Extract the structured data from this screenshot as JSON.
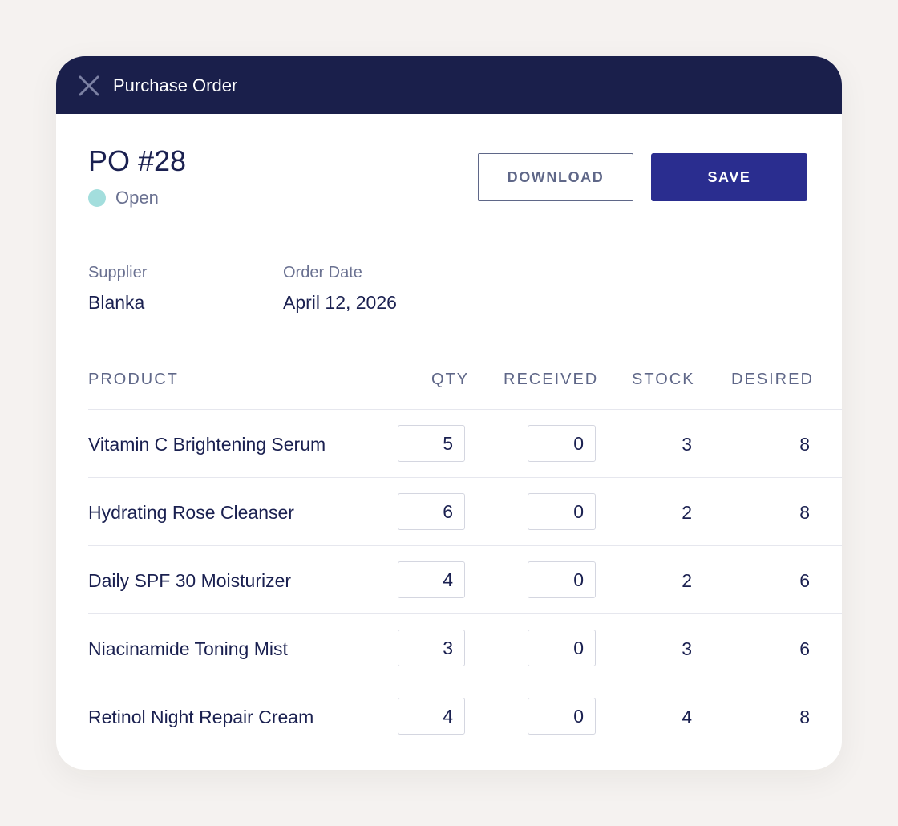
{
  "window": {
    "title": "Purchase Order"
  },
  "order": {
    "number": "PO #28",
    "status": "Open",
    "status_color": "#a3dedd"
  },
  "actions": {
    "download_label": "DOWNLOAD",
    "save_label": "SAVE"
  },
  "meta": {
    "supplier_label": "Supplier",
    "supplier_value": "Blanka",
    "date_label": "Order Date",
    "date_value": "April 12, 2026"
  },
  "table": {
    "headers": {
      "product": "PRODUCT",
      "qty": "QTY",
      "received": "RECEIVED",
      "stock": "STOCK",
      "desired": "DESIRED"
    },
    "rows": [
      {
        "product": "Vitamin C Brightening Serum",
        "qty": "5",
        "received": "0",
        "stock": "3",
        "desired": "8"
      },
      {
        "product": "Hydrating Rose Cleanser",
        "qty": "6",
        "received": "0",
        "stock": "2",
        "desired": "8"
      },
      {
        "product": "Daily SPF 30 Moisturizer",
        "qty": "4",
        "received": "0",
        "stock": "2",
        "desired": "6"
      },
      {
        "product": "Niacinamide Toning Mist",
        "qty": "3",
        "received": "0",
        "stock": "3",
        "desired": "6"
      },
      {
        "product": "Retinol Night Repair Cream",
        "qty": "4",
        "received": "0",
        "stock": "4",
        "desired": "8"
      }
    ]
  },
  "colors": {
    "header_bg": "#1a1f4b",
    "accent": "#2a2d8f",
    "text": "#1a2050",
    "muted": "#6a7191"
  }
}
